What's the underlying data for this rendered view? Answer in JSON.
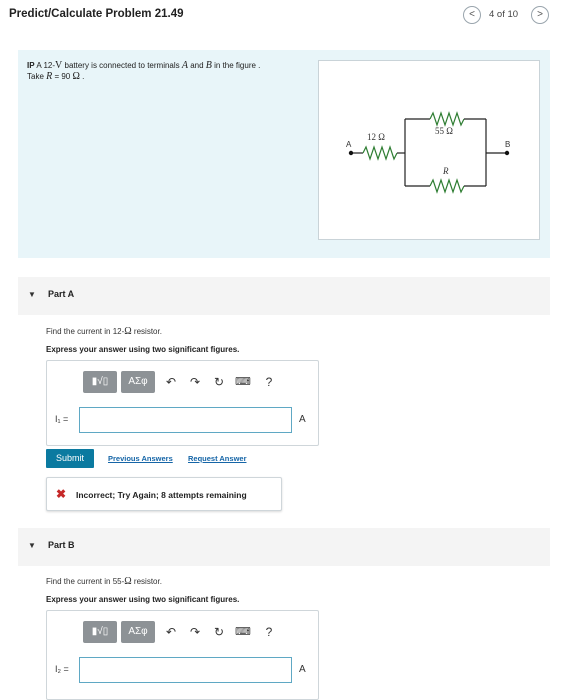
{
  "header": {
    "title": "Predict/Calculate Problem 21.49",
    "prev_icon": "<",
    "next_icon": ">",
    "counter": "4 of 10"
  },
  "problem": {
    "prefix": "IP",
    "text1": "A 12-",
    "volt_unit": "V",
    "text2": " battery is connected to terminals ",
    "term_a": "A",
    "and": " and ",
    "term_b": "B",
    "text3": " in the figure .",
    "take": "Take ",
    "r_sym": "R",
    "r_val": " = 90 ",
    "ohm": "Ω",
    "period": " ."
  },
  "figure": {
    "r1_label": "12 Ω",
    "r2_label": "55 Ω",
    "r3_label": "R",
    "node_a": "A",
    "node_b": "B"
  },
  "part_a": {
    "title": "Part A",
    "question_pre": "Find the current in 12-",
    "question_ohm": "Ω",
    "question_post": " resistor.",
    "instruction": "Express your answer using two significant figures.",
    "toolbar": {
      "templates_label": "▮√▯",
      "greek_label": "ΑΣφ",
      "help_label": "?"
    },
    "var_label": "I₁ =",
    "unit": "A",
    "input_value": "",
    "submit_label": "Submit",
    "prev_answers_label": "Previous Answers",
    "request_answer_label": "Request Answer",
    "feedback": "Incorrect; Try Again; 8 attempts remaining"
  },
  "part_b": {
    "title": "Part B",
    "question_pre": "Find the current in 55-",
    "question_ohm": "Ω",
    "question_post": " resistor.",
    "instruction": "Express your answer using two significant figures.",
    "toolbar": {
      "templates_label": "▮√▯",
      "greek_label": "ΑΣφ",
      "help_label": "?"
    },
    "var_label": "I₂ =",
    "unit": "A",
    "input_value": ""
  },
  "colors": {
    "problem_bg": "#e8f5f9",
    "submit_bg": "#0b7aa0",
    "link": "#1565a7",
    "error": "#c62828",
    "input_border": "#5fa8c4"
  }
}
